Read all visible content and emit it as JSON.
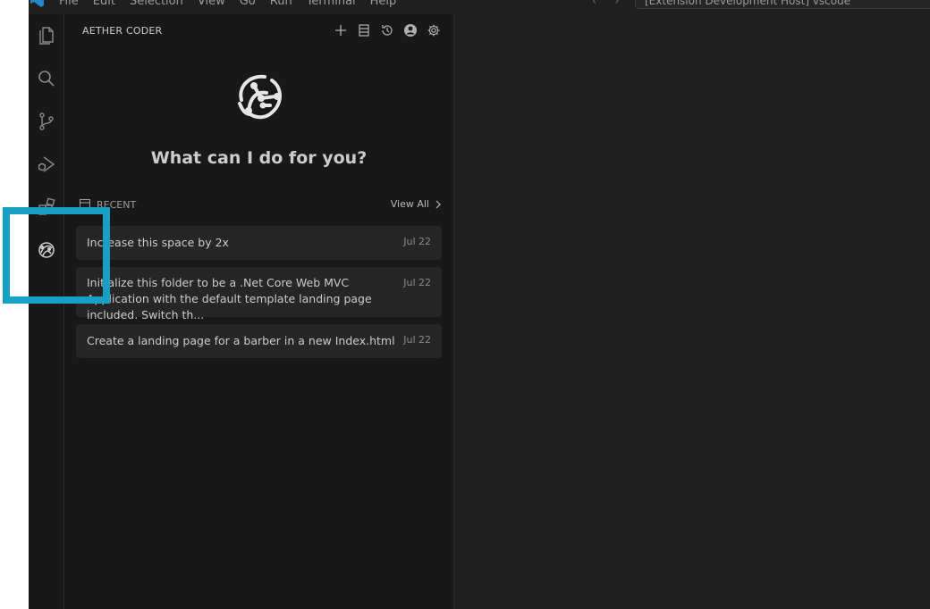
{
  "titlebar": {
    "menus": [
      "File",
      "Edit",
      "Selection",
      "View",
      "Go",
      "Run",
      "Terminal",
      "Help"
    ],
    "command_center": "[Extension Development Host] vscode"
  },
  "activitybar": {
    "icons": [
      "files-icon",
      "search-icon",
      "source-control-icon",
      "run-debug-icon",
      "extensions-icon",
      "aether-coder-icon"
    ]
  },
  "sidebar": {
    "title": "AETHER CODER",
    "actions": [
      "plus-icon",
      "layout-icon",
      "history-icon",
      "account-icon",
      "gear-icon"
    ],
    "hero_title": "What can I do for you?",
    "recent_label": "RECENT",
    "view_all": "View All",
    "recent_items": [
      {
        "text": "Increase this space by 2x",
        "date": "Jul 22"
      },
      {
        "text": "Initialize this folder to be a .Net Core Web MVC Application with the default template landing page included. Switch th...",
        "date": "Jul 22"
      },
      {
        "text": "Create a landing page for a barber in a new Index.html",
        "date": "Jul 22"
      }
    ]
  },
  "colors": {
    "background": "#181818",
    "card": "#262626",
    "highlight": "#16a0c4",
    "text": "#cccccc"
  }
}
